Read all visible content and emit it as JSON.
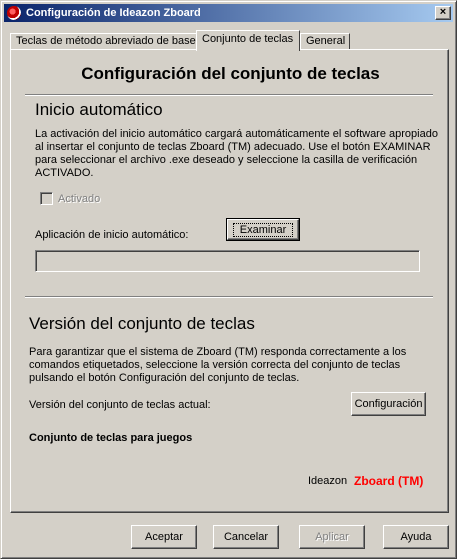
{
  "window": {
    "title": "Configuración de Ideazon Zboard",
    "close_label": "×"
  },
  "tabs": [
    {
      "label": "Teclas de método abreviado de base",
      "active": false
    },
    {
      "label": "Conjunto de teclas",
      "active": true
    },
    {
      "label": "General",
      "active": false
    }
  ],
  "panel": {
    "title": "Configuración del conjunto de teclas",
    "autostart": {
      "heading": "Inicio automático",
      "description_lines": [
        "La activación del inicio automático cargará automáticamente el software apropiado",
        "al insertar el conjunto de teclas Zboard (TM) adecuado. Use el botón EXAMINAR",
        "para seleccionar el archivo .exe deseado y seleccione la casilla de verificación",
        "ACTIVADO."
      ],
      "checkbox_label": "Activado",
      "checkbox_checked": false,
      "app_label": "Aplicación de inicio automático:",
      "browse_button": "Examinar",
      "app_path": ""
    },
    "version": {
      "heading": "Versión del conjunto de teclas",
      "description_lines": [
        "Para garantizar que el sistema de Zboard (TM) responda correctamente a los",
        "comandos etiquetados, seleccione la versión correcta del conjunto de teclas",
        "pulsando el botón Configuración del conjunto de teclas."
      ],
      "current_label": "Versión del conjunto de teclas actual:",
      "config_button": "Configuración",
      "current_value": "Conjunto de teclas para juegos",
      "brand_prefix": "Ideazon",
      "brand_name": "Zboard (TM)",
      "brand_color": "#ff0000"
    }
  },
  "footer": {
    "accept": "Aceptar",
    "cancel": "Cancelar",
    "apply": "Aplicar",
    "help": "Ayuda"
  },
  "colors": {
    "title_gradient_start": "#0a246a",
    "title_gradient_end": "#a6caf0",
    "face": "#d4d0c8"
  }
}
